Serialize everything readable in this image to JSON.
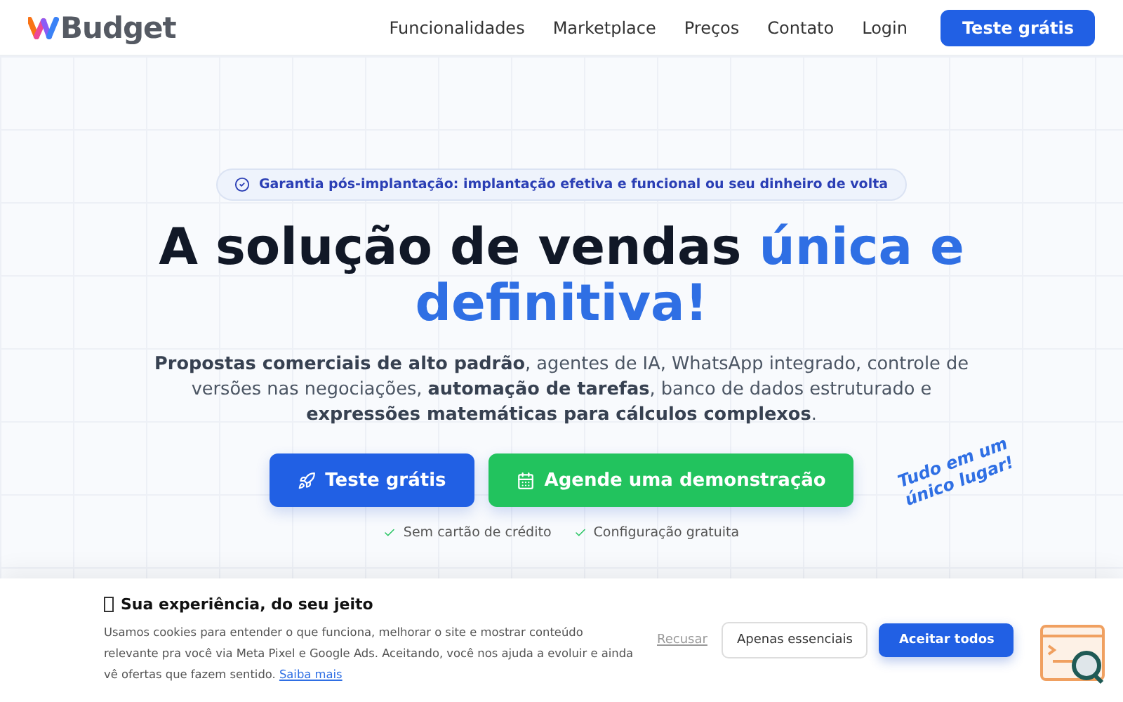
{
  "header": {
    "logo": "Budget",
    "nav": [
      "Funcionalidades",
      "Marketplace",
      "Preços",
      "Contato",
      "Login"
    ],
    "cta": "Teste grátis"
  },
  "hero": {
    "badge": "Garantia pós-implantação: implantação efetiva e funcional ou seu dinheiro de volta",
    "headline": [
      {
        "text": "A solução de vendas ",
        "highlight": false
      },
      {
        "text": "única e definitiva!",
        "highlight": true
      }
    ],
    "description": "**Propostas comerciais de alto padrão**, agentes de IA, WhatsApp integrado, controle de versões nas negociações, **automação de tarefas**, banco de dados estruturado e **expressões matemáticas para cálculos complexos**.",
    "stamp": [
      "Tudo em um",
      "único lugar!"
    ],
    "buttons": [
      {
        "kind": "primary",
        "label": "Teste grátis"
      },
      {
        "kind": "success",
        "label": "Agende uma demonstração"
      }
    ],
    "perks": [
      "Sem cartão de crédito",
      "Configuração gratuita"
    ]
  },
  "cookie": {
    "title": "Sua experiência, do seu jeito",
    "text": "Usamos cookies para entender o que funciona, melhorar o site e mostrar conteúdo relevante pra você via Meta Pixel e Google Ads. Aceitando, você nos ajuda a evoluir e ainda vê ofertas que fazem sentido.",
    "link": "Saiba mais",
    "buttons": [
      {
        "kind": "link",
        "label": "Recusar"
      },
      {
        "kind": "outline",
        "label": "Apenas essenciais"
      },
      {
        "kind": "primary",
        "label": "Aceitar todos"
      }
    ]
  }
}
